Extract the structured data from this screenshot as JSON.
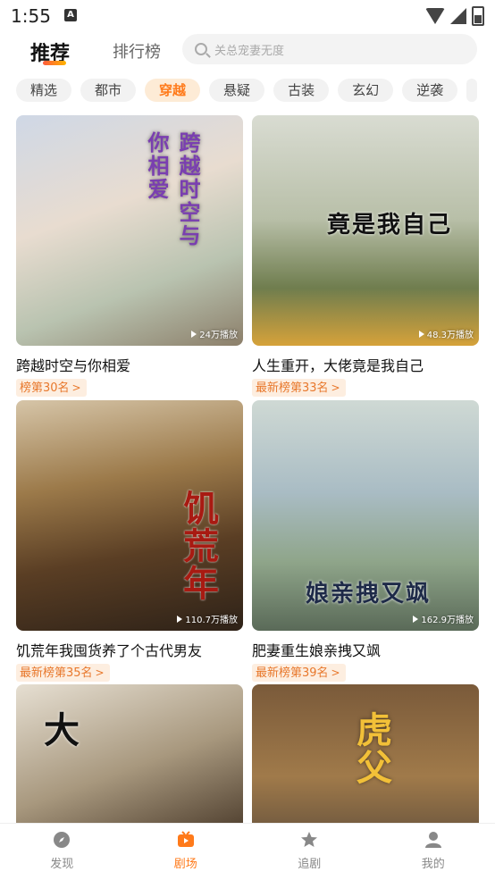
{
  "status": {
    "time": "1:55",
    "notif": "A"
  },
  "header": {
    "tab_main": "推荐",
    "tab_rank": "排行榜",
    "search_placeholder": "关总宠妻无度"
  },
  "chips": [
    "精选",
    "都市",
    "穿越",
    "悬疑",
    "古装",
    "玄幻",
    "逆袭"
  ],
  "active_chip": "穿越",
  "cards": [
    {
      "title": "跨越时空与你相爱",
      "badge": "榜第30名",
      "plays": "24万播放",
      "poster_text": "跨越时空与你相爱"
    },
    {
      "title": "人生重开，大佬竟是我自己",
      "badge": "最新榜第33名",
      "plays": "48.3万播放",
      "poster_text": "竟是我自己"
    },
    {
      "title": "饥荒年我囤货养了个古代男友",
      "badge": "最新榜第35名",
      "plays": "110.7万播放",
      "poster_text": "饥荒年"
    },
    {
      "title": "肥妻重生娘亲拽又飒",
      "badge": "最新榜第39名",
      "plays": "162.9万播放",
      "poster_text": "娘亲拽又飒"
    },
    {
      "title": "",
      "badge": "",
      "plays": "",
      "poster_text": "大"
    },
    {
      "title": "",
      "badge": "",
      "plays": "",
      "poster_text": "虎父"
    }
  ],
  "nav": [
    {
      "label": "发现",
      "icon": "compass-icon"
    },
    {
      "label": "剧场",
      "icon": "tv-icon"
    },
    {
      "label": "追剧",
      "icon": "star-icon"
    },
    {
      "label": "我的",
      "icon": "user-icon"
    }
  ],
  "colors": {
    "accent": "#ff7a1a",
    "chip_active_bg": "#fdebd6",
    "badge_bg": "#fdeee0"
  }
}
